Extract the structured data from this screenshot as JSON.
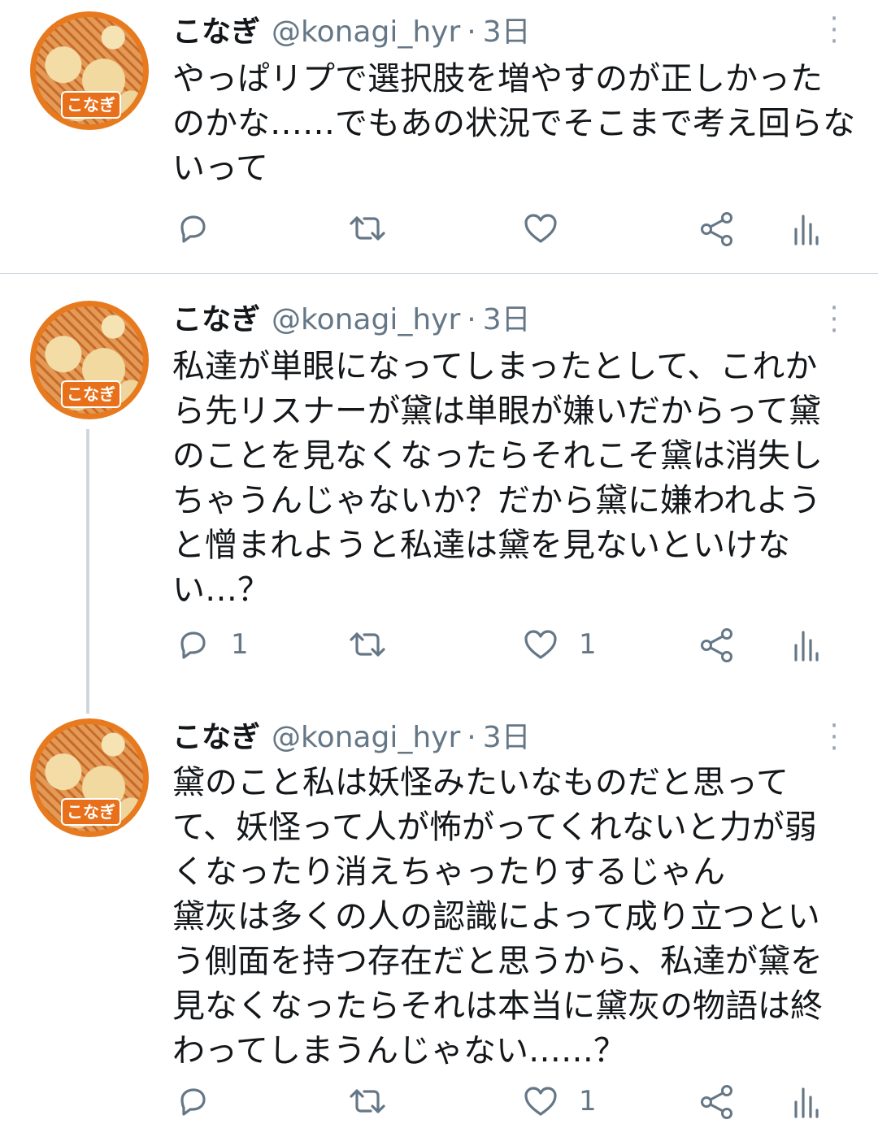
{
  "author": {
    "name": "こなぎ",
    "handle": "@konagi_hyr",
    "avatar_label": "こなぎ"
  },
  "tweets": [
    {
      "time": "3日",
      "text": "やっぱリプで選択肢を増やすのが正しかった\nのかな……でもあの状況でそこまで考え回らな\nいって",
      "reply_count": "",
      "like_count": ""
    },
    {
      "time": "3日",
      "text": "私達が単眼になってしまったとして、これか\nら先リスナーが黛は単眼が嫌いだからって黛\nのことを見なくなったらそれこそ黛は消失し\nちゃうんじゃないか？だから黛に嫌われよう\nと憎まれようと私達は黛を見ないといけな\nい…？",
      "reply_count": "1",
      "like_count": "1"
    },
    {
      "time": "3日",
      "text": "黛のこと私は妖怪みたいなものだと思って\nて、妖怪って人が怖がってくれないと力が弱\nくなったり消えちゃったりするじゃん\n黛灰は多くの人の認識によって成り立つとい\nう側面を持つ存在だと思うから、私達が黛を\n見なくなったらそれは本当に黛灰の物語は終\nわってしまうんじゃない……？",
      "reply_count": "",
      "like_count": "1"
    }
  ],
  "separator": "·",
  "icons": [
    "reply-icon",
    "retweet-icon",
    "like-icon",
    "share-icon",
    "analytics-icon",
    "more-icon"
  ],
  "colors": {
    "text": "#14171a",
    "secondary": "#657786",
    "divider": "#cfd7de"
  }
}
